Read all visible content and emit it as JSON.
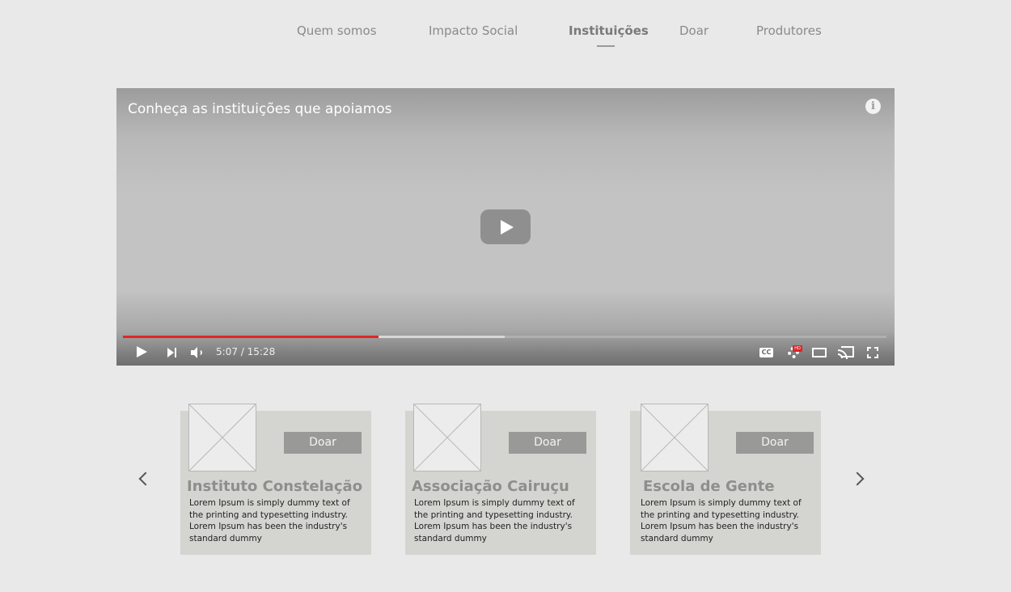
{
  "nav": {
    "items": [
      {
        "label": "Quem somos",
        "active": false
      },
      {
        "label": "Impacto Social",
        "active": false
      },
      {
        "label": "Instituições",
        "active": true
      },
      {
        "label": "Doar",
        "active": false
      },
      {
        "label": "Produtores",
        "active": false
      }
    ]
  },
  "video": {
    "title": "Conheça as instituições que apoiamos",
    "info_icon": "i",
    "time": "5:07 / 15:28",
    "played_fraction": 0.335,
    "buffered_fraction": 0.5,
    "cc_label": "CC",
    "hd_label": "HD",
    "progress_color": "#e0262b"
  },
  "cards": [
    {
      "title": "Instituto Constelação",
      "button_label": "Doar",
      "text": "Lorem Ipsum is simply dummy text of the printing and typesetting industry. Lorem Ipsum has been the industry's standard dummy"
    },
    {
      "title": "Associação Cairuçu",
      "button_label": "Doar",
      "text": "Lorem Ipsum is simply dummy text of the printing and typesetting industry. Lorem Ipsum has been the industry's standard dummy"
    },
    {
      "title": "Escola de Gente",
      "button_label": "Doar",
      "text": "Lorem Ipsum is simply dummy text of the printing and typesetting industry. Lorem Ipsum has been the industry's standard dummy"
    }
  ]
}
